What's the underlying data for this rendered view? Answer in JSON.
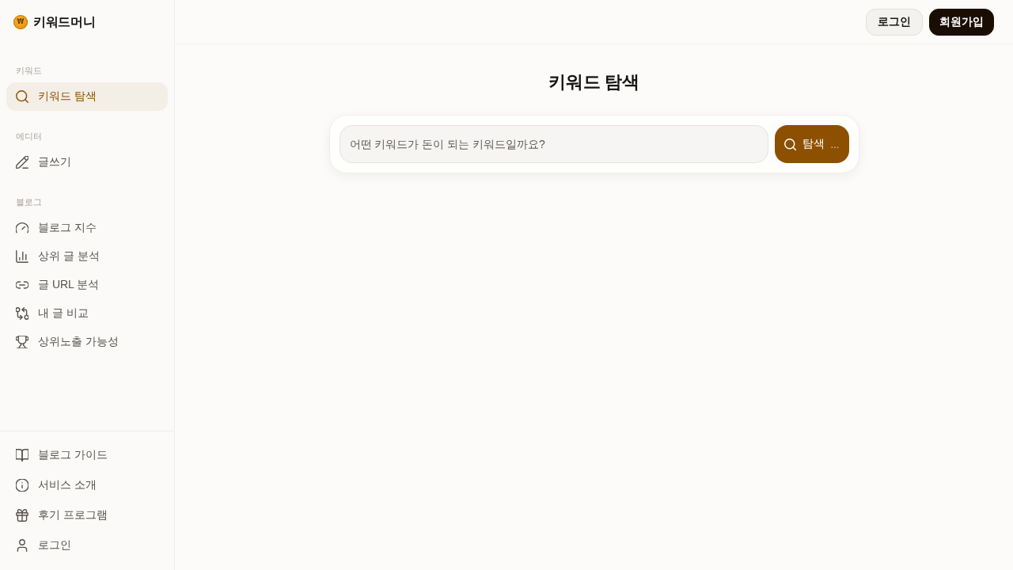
{
  "brand": {
    "logo_symbol": "₩",
    "name": "키워드머니"
  },
  "header": {
    "buttons": [
      {
        "label": "로그인",
        "kind": "secondary"
      },
      {
        "label": "회원가입",
        "kind": "primary"
      }
    ]
  },
  "sidebar": {
    "sections": [
      {
        "title": "키워드",
        "items": [
          {
            "label": "키워드 탐색",
            "selected": true
          }
        ]
      },
      {
        "title": "에디터",
        "items": [
          {
            "label": "글쓰기",
            "selected": false
          }
        ]
      },
      {
        "title": "블로그",
        "items": [
          {
            "label": "블로그 지수",
            "selected": false
          },
          {
            "label": "상위 글 분석",
            "selected": false
          },
          {
            "label": "글 URL 분석",
            "selected": false
          },
          {
            "label": "내 글 비교",
            "selected": false
          },
          {
            "label": "상위노출 가능성",
            "selected": false
          }
        ]
      }
    ],
    "footer_items": [
      {
        "label": "블로그 가이드",
        "selected": false
      },
      {
        "label": "서비스 소개",
        "selected": false
      },
      {
        "label": "후기 프로그램",
        "selected": false
      },
      {
        "label": "로그인",
        "selected": false
      }
    ]
  },
  "main": {
    "title": "키워드 탐색",
    "search": {
      "placeholder": "어떤 키워드가 돈이 되는 키워드일까요?",
      "button_label": "탐색",
      "button_hint": "..."
    }
  }
}
